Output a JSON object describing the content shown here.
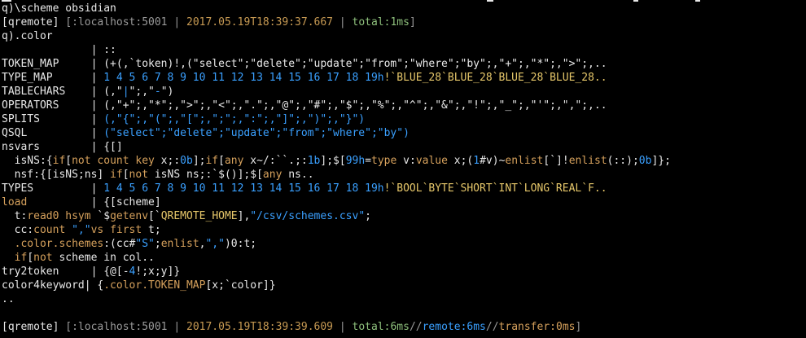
{
  "colors": {
    "default": "#e8e8e8",
    "gray": "#9a9a9a",
    "orange": "#d6a15c",
    "green": "#8ec07c",
    "blue": "#3aa0ff",
    "yellow": "#e6c76a",
    "brown": "#c79a53"
  },
  "lines": [
    [
      [
        "q)\\scheme obsidian",
        "default"
      ]
    ],
    [
      [
        "[qremote] ",
        "default"
      ],
      [
        "[:localhost:5001 | ",
        "gray"
      ],
      [
        "2017.05.19T18:39:37.667",
        "brown"
      ],
      [
        " | ",
        "gray"
      ],
      [
        "total:1ms",
        "green"
      ],
      [
        "]",
        "gray"
      ]
    ],
    [
      [
        "q).color",
        "default"
      ]
    ],
    [
      [
        "              | ::",
        "default"
      ]
    ],
    [
      [
        "TOKEN_MAP     | ",
        "default"
      ],
      [
        "(+(,`token)!,(\"select\";\"delete\";\"update\";\"from\";\"where\";\"by\";,\"+\";,\"*\";,\">\";,..",
        "default"
      ]
    ],
    [
      [
        "TYPE_MAP      | ",
        "default"
      ],
      [
        "1 4 5 6 7 8 9 10 11 12 13 14 15 16 17 18 19h",
        "blue"
      ],
      [
        "!`BLUE_28`BLUE_28`BLUE_28`BLUE_28..",
        "yellow"
      ]
    ],
    [
      [
        "TABLECHARS    | ",
        "default"
      ],
      [
        "(,\"",
        "default"
      ],
      [
        "|",
        "blue"
      ],
      [
        "\";,\"",
        "default"
      ],
      [
        "-",
        "blue"
      ],
      [
        "\")",
        "default"
      ]
    ],
    [
      [
        "OPERATORS     | ",
        "default"
      ],
      [
        "(,\"+\";,\"*\";,\">\";,\"<\";,\".\";,\"@\";,\"#\";,\"$\";,\"%\";,\"^\";,\"&\";,\"!\";,\"_\";,\"'\";,\",\";,..",
        "default"
      ]
    ],
    [
      [
        "SPLITS        | ",
        "default"
      ],
      [
        "(,\"{\";,\"(\";,\"[\";,\";\";,\":\";,\"]\";,\")\";,\"}\")",
        "blue"
      ]
    ],
    [
      [
        "QSQL          | ",
        "default"
      ],
      [
        "(\"select\";\"delete\";\"update\";\"from\";\"where\";\"by\")",
        "blue"
      ]
    ],
    [
      [
        "nsvars        | ",
        "default"
      ],
      [
        "{[]",
        "default"
      ]
    ],
    [
      [
        "  isNS:{",
        "default"
      ],
      [
        "if",
        "orange"
      ],
      [
        "[",
        "default"
      ],
      [
        "not count key",
        "orange"
      ],
      [
        " x;:",
        "default"
      ],
      [
        "0b",
        "blue"
      ],
      [
        "];",
        "default"
      ],
      [
        "if",
        "orange"
      ],
      [
        "[",
        "default"
      ],
      [
        "any",
        "orange"
      ],
      [
        " x~/:``.;:",
        "default"
      ],
      [
        "1b",
        "blue"
      ],
      [
        "];$[",
        "default"
      ],
      [
        "99h",
        "blue"
      ],
      [
        "=",
        "default"
      ],
      [
        "type",
        "orange"
      ],
      [
        " v:",
        "default"
      ],
      [
        "value",
        "orange"
      ],
      [
        " x;(",
        "default"
      ],
      [
        "1",
        "blue"
      ],
      [
        "#v)~",
        "default"
      ],
      [
        "enlist",
        "orange"
      ],
      [
        "[`]!",
        "default"
      ],
      [
        "enlist",
        "orange"
      ],
      [
        "(::);",
        "default"
      ],
      [
        "0b",
        "blue"
      ],
      [
        "]};",
        "default"
      ]
    ],
    [
      [
        "  nsf:{[isNS;ns] ",
        "default"
      ],
      [
        "if",
        "orange"
      ],
      [
        "[",
        "default"
      ],
      [
        "not",
        "orange"
      ],
      [
        " isNS ns;:`$()];$[",
        "default"
      ],
      [
        "any",
        "orange"
      ],
      [
        " ns..",
        "default"
      ]
    ],
    [
      [
        "TYPES         | ",
        "default"
      ],
      [
        "1 4 5 6 7 8 9 10 11 12 13 14 15 16 17 18 19h",
        "blue"
      ],
      [
        "!`BOOL`BYTE`SHORT`INT`LONG`REAL`F..",
        "yellow"
      ]
    ],
    [
      [
        "load",
        "orange"
      ],
      [
        "          | {[scheme]",
        "default"
      ]
    ],
    [
      [
        "  t:",
        "default"
      ],
      [
        "read0",
        "orange"
      ],
      [
        " ",
        "default"
      ],
      [
        "hsym",
        "orange"
      ],
      [
        " `$",
        "default"
      ],
      [
        "getenv",
        "orange"
      ],
      [
        "[`",
        "default"
      ],
      [
        "QREMOTE_HOME",
        "yellow"
      ],
      [
        "],",
        "default"
      ],
      [
        "\"/csv/schemes.csv\"",
        "blue"
      ],
      [
        ";",
        "default"
      ]
    ],
    [
      [
        "  cc:",
        "default"
      ],
      [
        "count",
        "orange"
      ],
      [
        " ",
        "default"
      ],
      [
        "\",\"",
        "blue"
      ],
      [
        "vs",
        "orange"
      ],
      [
        " ",
        "default"
      ],
      [
        "first",
        "orange"
      ],
      [
        " t;",
        "default"
      ]
    ],
    [
      [
        "  ",
        "default"
      ],
      [
        ".color.schemes",
        "orange"
      ],
      [
        ":(cc#",
        "default"
      ],
      [
        "\"S\"",
        "blue"
      ],
      [
        ";",
        "default"
      ],
      [
        "enlist",
        "orange"
      ],
      [
        ",",
        "default"
      ],
      [
        "\",\"",
        "blue"
      ],
      [
        ")0:t;",
        "default"
      ]
    ],
    [
      [
        "  ",
        "default"
      ],
      [
        "if",
        "orange"
      ],
      [
        "[",
        "default"
      ],
      [
        "not",
        "orange"
      ],
      [
        " scheme in col..",
        "default"
      ]
    ],
    [
      [
        "try2token     | {@[-",
        "default"
      ],
      [
        "4",
        "blue"
      ],
      [
        "!;x;y]}",
        "default"
      ]
    ],
    [
      [
        "color4keyword| {",
        "default"
      ],
      [
        ".color.TOKEN_MAP",
        "orange"
      ],
      [
        "[x;`color]}",
        "default"
      ]
    ],
    [
      [
        "..",
        "default"
      ]
    ],
    [
      [
        "",
        "default"
      ]
    ],
    [
      [
        "[qremote] ",
        "default"
      ],
      [
        "[:localhost:5001 | ",
        "gray"
      ],
      [
        "2017.05.19T18:39:39.609",
        "brown"
      ],
      [
        " | ",
        "gray"
      ],
      [
        "total:6ms",
        "green"
      ],
      [
        "//",
        "gray"
      ],
      [
        "remote:6ms",
        "blue"
      ],
      [
        "//",
        "gray"
      ],
      [
        "transfer:0ms",
        "orange"
      ],
      [
        "]",
        "gray"
      ]
    ]
  ]
}
